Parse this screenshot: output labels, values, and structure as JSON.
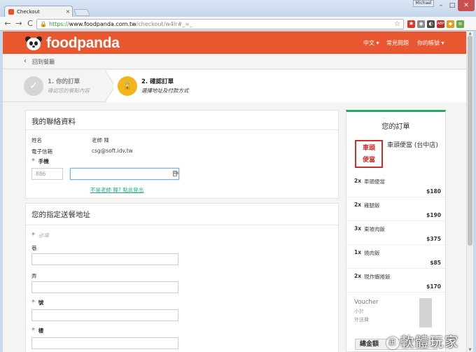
{
  "browser": {
    "tab_title": "Checkout",
    "tab_close": "×",
    "user_badge": "Michael",
    "url_scheme": "https://",
    "url_host": "www.foodpanda.com.tw",
    "url_path": "/checkout/w4lr#_=_",
    "back": "←",
    "forward": "→",
    "reload": "C",
    "minimize": "–",
    "maximize": "□",
    "close": "✕",
    "star": "☆",
    "extensions": [
      {
        "name": "ext-red",
        "color": "#d83b2b",
        "label": "✱"
      },
      {
        "name": "ext-gray",
        "color": "#8a8a8a",
        "label": "◉"
      },
      {
        "name": "ext-dark",
        "color": "#4a4a4a",
        "label": "◐"
      },
      {
        "name": "ext-abp",
        "color": "#c0312b",
        "label": "ABP"
      },
      {
        "name": "ext-tag",
        "color": "#e0a020",
        "label": "◆"
      },
      {
        "name": "ext-menu",
        "color": "#6aa84f",
        "label": "≡"
      }
    ]
  },
  "header": {
    "brand": "foodpanda",
    "lang": "中文 ▾",
    "faq": "常見問題",
    "account": "你的帳號 ▾",
    "color": "#e8572f"
  },
  "back_link": {
    "icon": "‹",
    "label": "回到餐廳"
  },
  "steps": [
    {
      "title": "1. 你的訂單",
      "subtitle": "確認您的餐點內容",
      "icon": "✓"
    },
    {
      "title": "2. 確認訂單",
      "subtitle": "選擇地址及付款方式",
      "icon": "🔒"
    }
  ],
  "contact": {
    "title": "我的聯絡資料",
    "name_label": "姓名",
    "name_value": "老師 陳",
    "email_label": "電子信箱",
    "email_value": "csg@soft.idv.tw",
    "phone_label": "手機",
    "phone_prefix": "886",
    "phone_value": "",
    "kb_icon": "⌨",
    "not_you_link": "不是老師 陳? 點此登出"
  },
  "address": {
    "title": "您的指定送餐地址",
    "required_hint": "必填",
    "fields": [
      {
        "label": "巷",
        "required": false
      },
      {
        "label": "弄",
        "required": false
      },
      {
        "label": "號",
        "required": true
      },
      {
        "label": "樓",
        "required": true
      }
    ]
  },
  "order": {
    "title": "您的訂單",
    "restaurant_logo": "車頭\n便當",
    "restaurant": "車頭便當 (台中店)",
    "items": [
      {
        "qty": "2x",
        "name": "車頭便當",
        "price": "$180"
      },
      {
        "qty": "2x",
        "name": "雞腿飯",
        "price": "$190"
      },
      {
        "qty": "3x",
        "name": "東坡肉飯",
        "price": "$375"
      },
      {
        "qty": "1x",
        "name": "燒肉飯",
        "price": "$85"
      },
      {
        "qty": "2x",
        "name": "現炸蝦捲飯",
        "price": "$170"
      }
    ],
    "voucher": "Voucher",
    "subtotal": "小計",
    "delivery_fee": "外送費",
    "total_label": "總金額",
    "accent": "#2aa86a"
  },
  "watermark": {
    "circle": "正",
    "text": "軟體玩家"
  }
}
